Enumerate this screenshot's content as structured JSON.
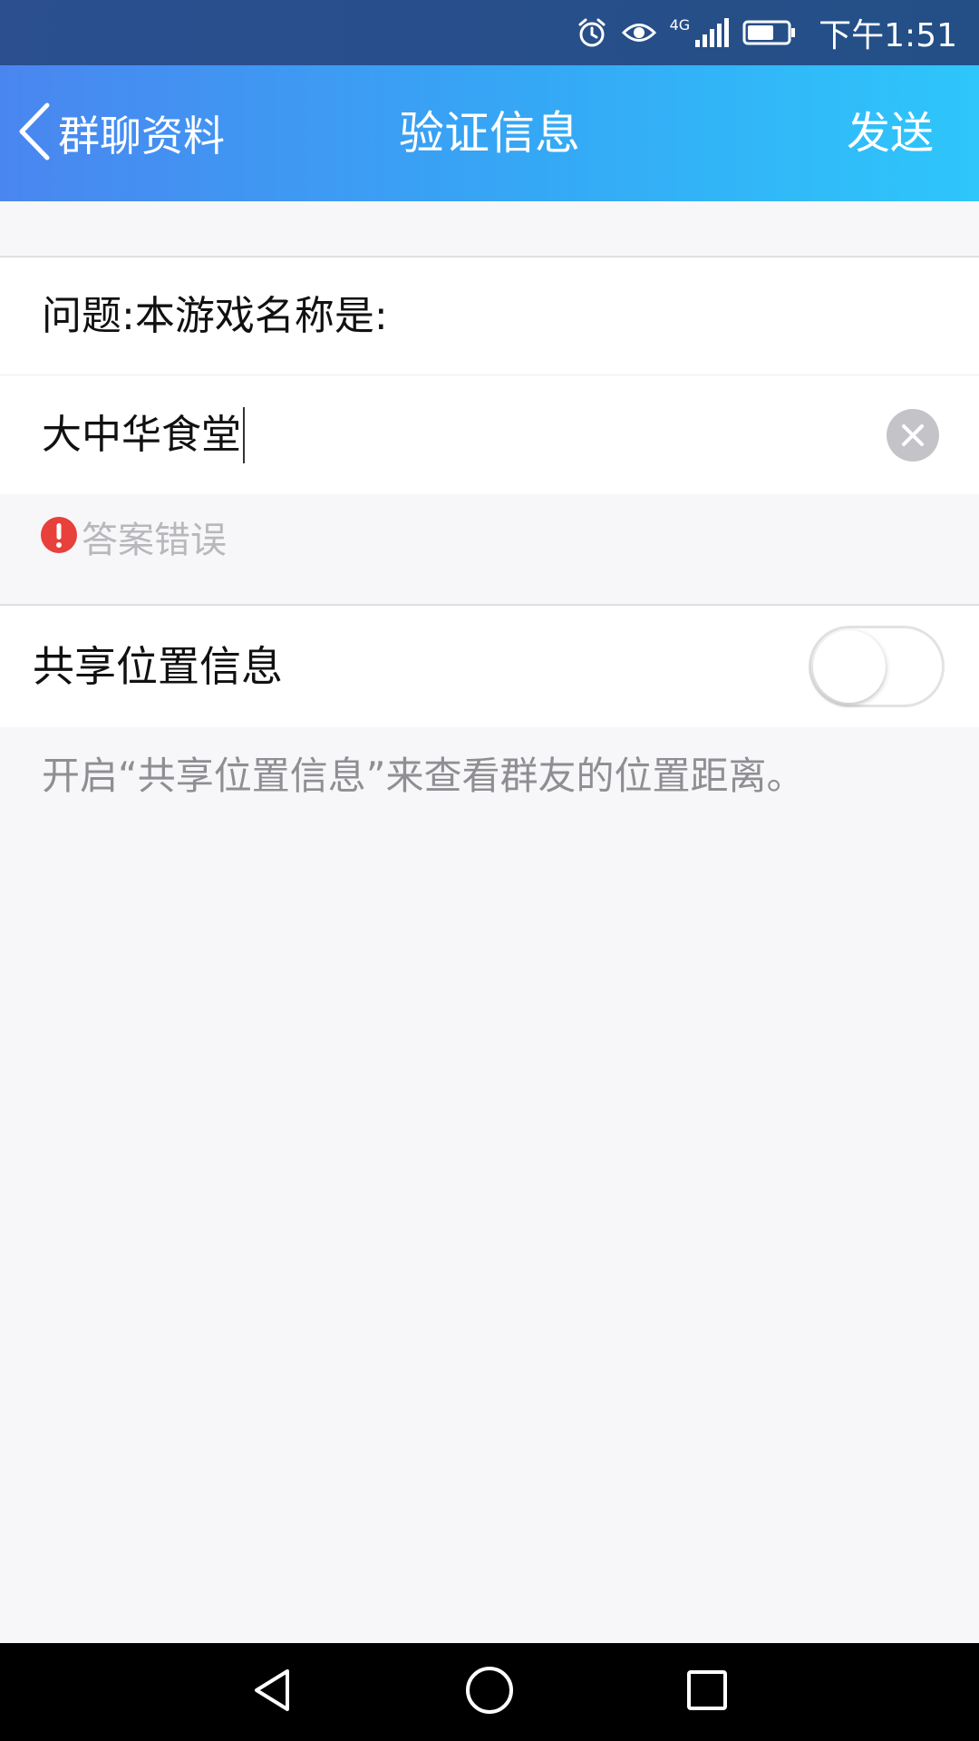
{
  "status_bar": {
    "time": "下午1:51",
    "network_label": "4G",
    "icons": [
      "alarm-icon",
      "eye-icon",
      "signal-icon",
      "battery-icon"
    ]
  },
  "header": {
    "back_label": "群聊资料",
    "title": "验证信息",
    "send_label": "发送"
  },
  "form": {
    "question": "问题:本游戏名称是:",
    "answer_value": "大中华食堂",
    "error_text": "答案错误"
  },
  "location": {
    "label": "共享位置信息",
    "enabled": false,
    "hint": "开启“共享位置信息”来查看群友的位置距离。"
  },
  "nav_bar": {
    "icons": [
      "back-triangle-icon",
      "home-circle-icon",
      "recents-square-icon"
    ]
  },
  "colors": {
    "header_gradient_start": "#4a86f0",
    "header_gradient_end": "#2ec6fb",
    "status_bar": "#2b4f8f",
    "error_red": "#e8403a",
    "background": "#f7f7f9"
  }
}
